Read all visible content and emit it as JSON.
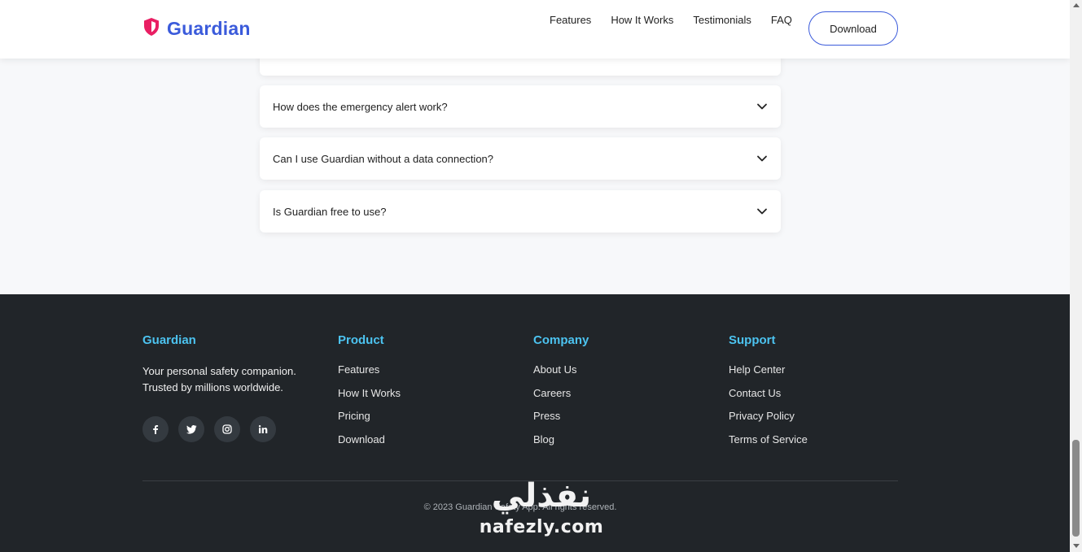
{
  "header": {
    "brand": "Guardian",
    "nav": [
      "Features",
      "How It Works",
      "Testimonials",
      "FAQ"
    ],
    "download_label": "Download",
    "colors": {
      "brand": "#3b5bdb",
      "shield": "#e91e63"
    }
  },
  "faq": {
    "items": [
      "How does the emergency alert work?",
      "Can I use Guardian without a data connection?",
      "Is Guardian free to use?"
    ]
  },
  "footer": {
    "brand": {
      "title": "Guardian",
      "tagline": "Your personal safety companion. Trusted by millions worldwide.",
      "socials": [
        "facebook-icon",
        "twitter-icon",
        "instagram-icon",
        "linkedin-icon"
      ]
    },
    "product": {
      "title": "Product",
      "links": [
        "Features",
        "How It Works",
        "Pricing",
        "Download"
      ]
    },
    "company": {
      "title": "Company",
      "links": [
        "About Us",
        "Careers",
        "Press",
        "Blog"
      ]
    },
    "support": {
      "title": "Support",
      "links": [
        "Help Center",
        "Contact Us",
        "Privacy Policy",
        "Terms of Service"
      ]
    },
    "copyright": "© 2023 Guardian Safety App. All rights reserved.",
    "colors": {
      "background": "#212529",
      "heading": "#4cc3f0"
    }
  },
  "watermark": {
    "arabic": "نفذلي",
    "latin": "nafezly.com"
  }
}
